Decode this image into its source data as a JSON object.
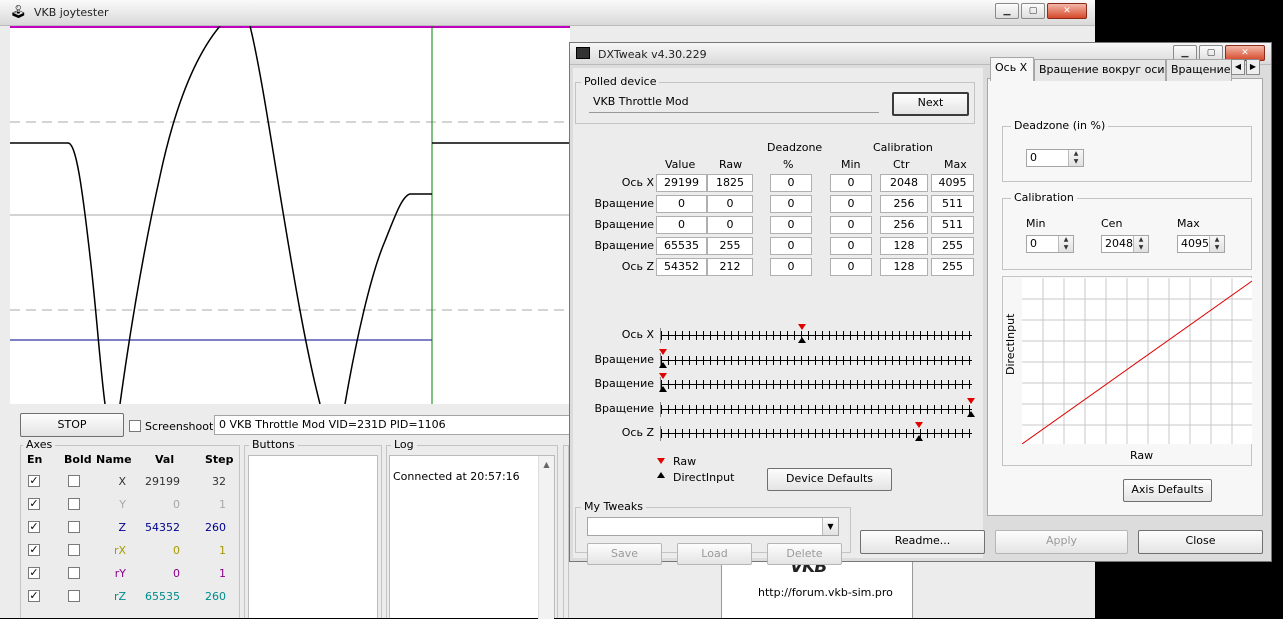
{
  "joytester": {
    "title": "VKB joytester",
    "stop_label": "STOP",
    "screenshot_label": "Screenshoot",
    "device_info": "0 VKB Throttle Mod VID=231D PID=1106",
    "axes": {
      "title": "Axes",
      "headers": [
        "En",
        "Bold",
        "Name",
        "Val",
        "Step"
      ],
      "rows": [
        {
          "enabled": true,
          "bold": false,
          "name": "X",
          "val": "29199",
          "step": "32",
          "color": "#333333"
        },
        {
          "enabled": true,
          "bold": false,
          "name": "Y",
          "val": "0",
          "step": "1",
          "color": "#a8a8a8"
        },
        {
          "enabled": true,
          "bold": false,
          "name": "Z",
          "val": "54352",
          "step": "260",
          "color": "#00008b"
        },
        {
          "enabled": true,
          "bold": false,
          "name": "rX",
          "val": "0",
          "step": "1",
          "color": "#a59a00"
        },
        {
          "enabled": true,
          "bold": false,
          "name": "rY",
          "val": "0",
          "step": "1",
          "color": "#8b008b"
        },
        {
          "enabled": true,
          "bold": false,
          "name": "rZ",
          "val": "65535",
          "step": "260",
          "color": "#008b8b"
        }
      ]
    },
    "buttons_title": "Buttons",
    "log": {
      "title": "Log",
      "text": "Connected at 20:57:16"
    },
    "forum_url": "http://forum.vkb-sim.pro",
    "graph_colors": {
      "curve": "#000000",
      "hline": "#00008b",
      "vline": "#008000",
      "top": "#c000c0"
    }
  },
  "dxtweak": {
    "title": "DXTweak v4.30.229",
    "polled_device": {
      "title": "Polled device",
      "value": "VKB Throttle Mod",
      "next_label": "Next"
    },
    "table": {
      "group_headers": {
        "deadzone": "Deadzone",
        "calibration": "Calibration"
      },
      "headers": [
        "Value",
        "Raw",
        "%",
        "Min",
        "Ctr",
        "Max"
      ],
      "rows": [
        {
          "label": "Ось X",
          "value": "29199",
          "raw": "1825",
          "dz": "0",
          "min": "0",
          "ctr": "2048",
          "max": "4095"
        },
        {
          "label": "Вращение",
          "value": "0",
          "raw": "0",
          "dz": "0",
          "min": "0",
          "ctr": "256",
          "max": "511"
        },
        {
          "label": "Вращение",
          "value": "0",
          "raw": "0",
          "dz": "0",
          "min": "0",
          "ctr": "256",
          "max": "511"
        },
        {
          "label": "Вращение",
          "value": "65535",
          "raw": "255",
          "dz": "0",
          "min": "0",
          "ctr": "128",
          "max": "255"
        },
        {
          "label": "Ось Z",
          "value": "54352",
          "raw": "212",
          "dz": "0",
          "min": "0",
          "ctr": "128",
          "max": "255"
        }
      ]
    },
    "bars": [
      {
        "label": "Ось X",
        "raw": 0.45,
        "di": 0.45
      },
      {
        "label": "Вращение",
        "raw": 0.0,
        "di": 0.0
      },
      {
        "label": "Вращение",
        "raw": 0.0,
        "di": 0.0
      },
      {
        "label": "Вращение",
        "raw": 1.0,
        "di": 1.0
      },
      {
        "label": "Ось Z",
        "raw": 0.83,
        "di": 0.83
      }
    ],
    "legend": {
      "raw": "Raw",
      "directinput": "DirectInput"
    },
    "device_defaults_label": "Device Defaults",
    "my_tweaks": {
      "title": "My Tweaks",
      "value": "",
      "save": "Save",
      "load": "Load",
      "delete": "Delete"
    },
    "tabs": [
      "Ось X",
      "Вращение вокруг оси Х",
      "Вращение в"
    ],
    "deadzone": {
      "title": "Deadzone (in %)",
      "value": "0"
    },
    "calibration": {
      "title": "Calibration",
      "min_label": "Min",
      "min": "0",
      "cen_label": "Cen",
      "cen": "2048",
      "max_label": "Max",
      "max": "4095"
    },
    "curve": {
      "x_label": "Raw",
      "y_label": "DirectInput",
      "line_color": "#e00000"
    },
    "axis_defaults_label": "Axis Defaults",
    "bottom": {
      "readme": "Readme...",
      "apply": "Apply",
      "close": "Close"
    }
  }
}
